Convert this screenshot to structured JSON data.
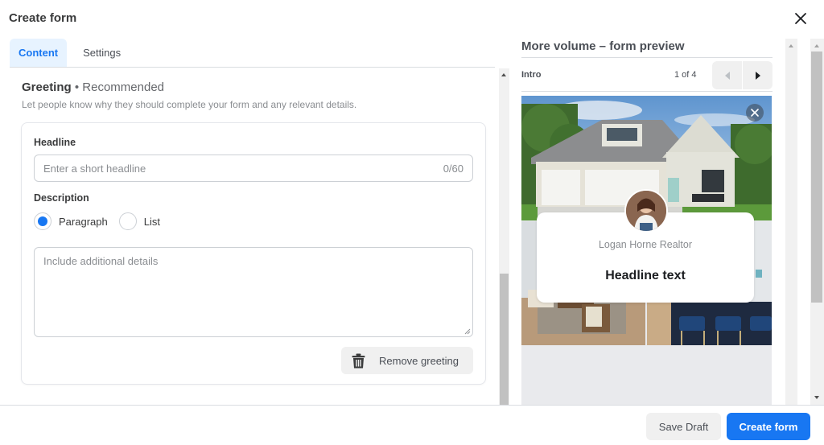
{
  "dialog": {
    "title": "Create form",
    "close_icon": "close-icon"
  },
  "tabs": [
    {
      "label": "Content",
      "active": true
    },
    {
      "label": "Settings",
      "active": false
    }
  ],
  "greeting": {
    "title": "Greeting",
    "separator": " • ",
    "tag": "Recommended",
    "subtitle": "Let people know why they should complete your form and any relevant details.",
    "headline": {
      "label": "Headline",
      "value": "",
      "placeholder": "Enter a short headline",
      "counter": "0/60"
    },
    "description": {
      "label": "Description",
      "options": [
        {
          "label": "Paragraph",
          "selected": true
        },
        {
          "label": "List",
          "selected": false
        }
      ],
      "value": "",
      "placeholder": "Include additional details"
    },
    "remove_button": {
      "label": "Remove greeting",
      "icon": "trash-icon"
    }
  },
  "preview": {
    "title": "More volume – form preview",
    "step_label": "Intro",
    "page_indicator": "1 of 4",
    "current_page": 1,
    "total_pages": 4,
    "prev_icon": "triangle-left-icon",
    "next_icon": "triangle-right-icon",
    "page_name": "Logan Horne Realtor",
    "headline_text": "Headline text"
  },
  "footer": {
    "save_draft": "Save Draft",
    "create_form": "Create form"
  },
  "colors": {
    "accent": "#1877f2",
    "active_tab_bg": "#e7f3ff",
    "button_secondary_bg": "#f0f0f0"
  }
}
